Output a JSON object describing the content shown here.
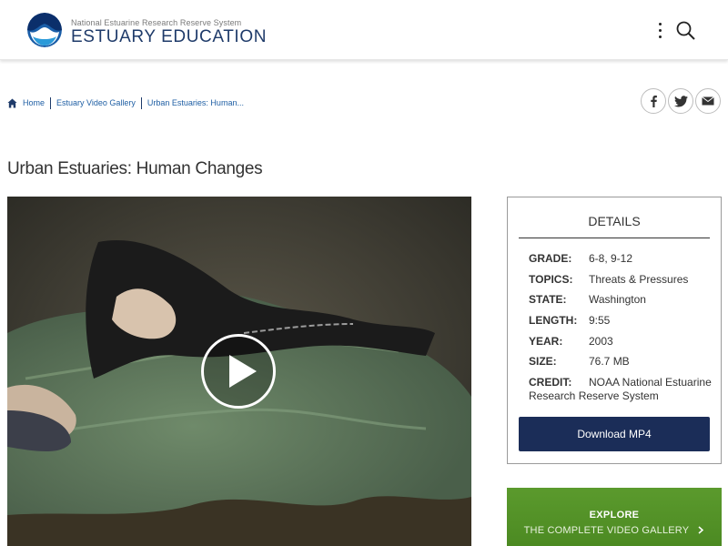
{
  "header": {
    "subtitle": "National Estuarine Research Reserve System",
    "title": "ESTUARY EDUCATION",
    "logo_icon": "noaa-logo",
    "menu_icon": "kebab-menu-icon",
    "search_icon": "search-icon"
  },
  "breadcrumb": {
    "items": [
      "Home",
      "Estuary Video Gallery",
      "Urban Estuaries: Human..."
    ]
  },
  "share": {
    "facebook_icon": "facebook-icon",
    "twitter_icon": "twitter-icon",
    "email_icon": "email-icon"
  },
  "page": {
    "title": "Urban Estuaries: Human Changes"
  },
  "video": {
    "play_icon": "play-icon"
  },
  "details": {
    "title": "DETAILS",
    "rows": [
      {
        "label": "GRADE:",
        "value": "6-8, 9-12"
      },
      {
        "label": "TOPICS:",
        "value": "Threats & Pressures"
      },
      {
        "label": "STATE:",
        "value": "Washington"
      },
      {
        "label": "LENGTH:",
        "value": "9:55"
      },
      {
        "label": "YEAR:",
        "value": "2003"
      },
      {
        "label": "SIZE:",
        "value": "76.7 MB"
      }
    ],
    "credit_label": "CREDIT:",
    "credit_value": "NOAA National Estuarine Research Reserve System",
    "download_label": "Download MP4"
  },
  "explore": {
    "title": "EXPLORE",
    "subtitle": "THE COMPLETE VIDEO GALLERY"
  },
  "colors": {
    "brand_navy": "#1b2d58",
    "link_blue": "#1f5fa4",
    "explore_green": "#4c8a22"
  }
}
